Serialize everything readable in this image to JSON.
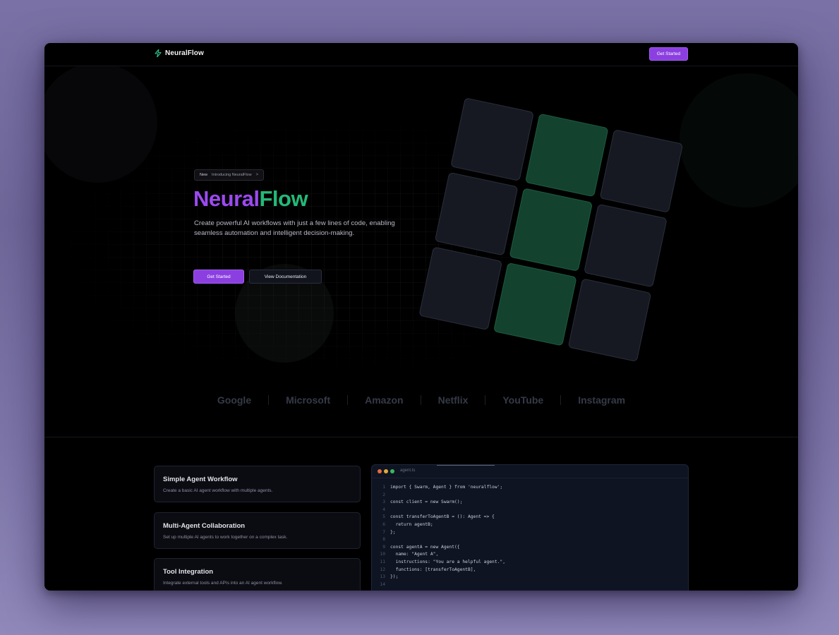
{
  "nav": {
    "brand": "NeuralFlow",
    "cta": "Get Started"
  },
  "hero": {
    "badge_new": "New",
    "badge_text": "Introducing NeuralFlow",
    "badge_chevron": ">",
    "title_part1": "Neural",
    "title_part2": "Flow",
    "description": "Create powerful AI workflows with just a few lines of code, enabling seamless automation and intelligent decision-making.",
    "primary_button": "Get Started",
    "secondary_button": "View Documentation"
  },
  "colors": {
    "accent_purple": "#8b3fe0",
    "accent_green": "#23b978"
  },
  "brands": [
    "Google",
    "Microsoft",
    "Amazon",
    "Netflix",
    "YouTube",
    "Instagram"
  ],
  "examples": [
    {
      "title": "Simple Agent Workflow",
      "desc": "Create a basic AI agent workflow with multiple agents."
    },
    {
      "title": "Multi-Agent Collaboration",
      "desc": "Set up multiple AI agents to work together on a complex task."
    },
    {
      "title": "Tool Integration",
      "desc": "Integrate external tools and APIs into an AI agent workflow."
    }
  ],
  "code": {
    "filename": "agent.ts",
    "lines": [
      "import { Swarm, Agent } from 'neuralflow';",
      "",
      "const client = new Swarm();",
      "",
      "const transferToAgentB = (): Agent => {",
      "  return agentB;",
      "};",
      "",
      "const agentA = new Agent({",
      "  name: \"Agent A\",",
      "  instructions: \"You are a helpful agent.\",",
      "  functions: [transferToAgentB],",
      "});",
      ""
    ]
  }
}
